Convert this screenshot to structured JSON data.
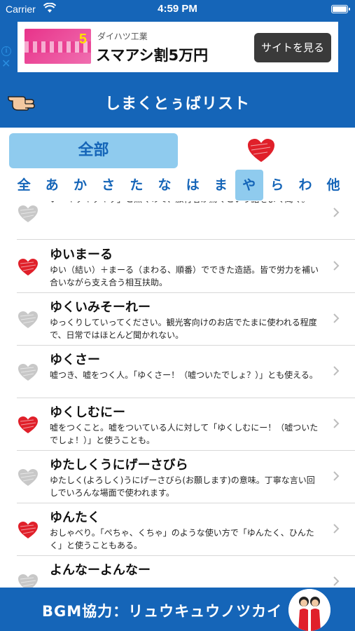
{
  "status_bar": {
    "carrier": "Carrier",
    "time": "4:59 PM"
  },
  "ad": {
    "sponsor": "ダイハツ工業",
    "title": "スマアシ割5万円",
    "button": "サイトを見る",
    "info": "i",
    "close": "✕"
  },
  "nav": {
    "title": "しまくとぅばリスト",
    "back_icon": "pointing-hand-icon"
  },
  "filter": {
    "all_label": "全部",
    "favorites_icon": "heart-icon",
    "kana": [
      "全",
      "あ",
      "か",
      "さ",
      "た",
      "な",
      "は",
      "ま",
      "や",
      "ら",
      "わ",
      "他"
    ],
    "active_kana": "や"
  },
  "list": {
    "items": [
      {
        "word": "",
        "desc": "い「キッキッキッ」と無くので、旅行者が驚くという話をよく聞く。",
        "favorite": false
      },
      {
        "word": "ゆいまーる",
        "desc": "ゆい（結い）＋まーる（まわる、順番）でできた造語。皆で労力を補い合いながら支え合う相互扶助。",
        "favorite": true
      },
      {
        "word": "ゆくいみそーれー",
        "desc": "ゆっくりしていってください。観光客向けのお店でたまに使われる程度で、日常ではほとんど聞かれない。",
        "favorite": false
      },
      {
        "word": "ゆくさー",
        "desc": "嘘つき、嘘をつく人。「ゆくさー！（嘘ついたでしょ？）」とも使える。",
        "favorite": false
      },
      {
        "word": "ゆくしむにー",
        "desc": "嘘をつくこと。嘘をついている人に対して「ゆくしむにー！（嘘ついたでしょ！）」と使うことも。",
        "favorite": true
      },
      {
        "word": "ゆたしくうにげーさびら",
        "desc": "ゆたしく(よろしく)うにげーさびら(お願します)の意味。丁寧な言い回しでいろんな場面で使われます。",
        "favorite": false
      },
      {
        "word": "ゆんたく",
        "desc": "おしゃべり。「ぺちゃ、くちゃ」のような使い方で「ゆんたく、ひんたく」と使うこともある。",
        "favorite": true
      },
      {
        "word": "よんなーよんなー",
        "desc": "",
        "favorite": false
      }
    ]
  },
  "footer": {
    "credit": "BGM協力：リュウキュウノツカイ"
  },
  "colors": {
    "brand_blue": "#1565b8",
    "tab_highlight": "#8fcbee",
    "heart_red": "#e0202a",
    "heart_gray": "#c8c8c8"
  }
}
